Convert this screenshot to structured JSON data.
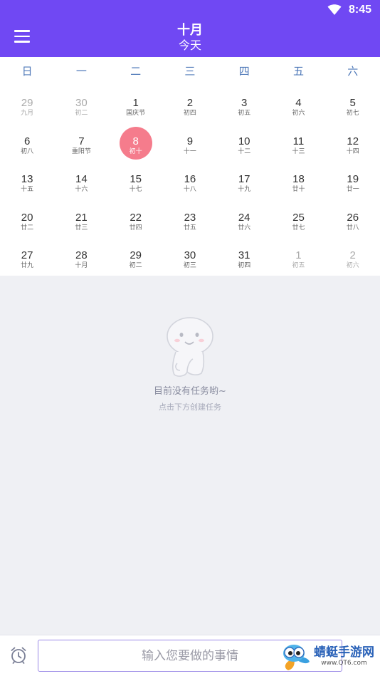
{
  "status": {
    "time": "8:45"
  },
  "header": {
    "month": "十月",
    "today": "今天"
  },
  "weekdays": [
    "日",
    "一",
    "二",
    "三",
    "四",
    "五",
    "六"
  ],
  "weeks": [
    [
      {
        "day": "29",
        "sub": "九月",
        "other": true
      },
      {
        "day": "30",
        "sub": "初二",
        "other": true
      },
      {
        "day": "1",
        "sub": "国庆节"
      },
      {
        "day": "2",
        "sub": "初四"
      },
      {
        "day": "3",
        "sub": "初五"
      },
      {
        "day": "4",
        "sub": "初六"
      },
      {
        "day": "5",
        "sub": "初七"
      }
    ],
    [
      {
        "day": "6",
        "sub": "初八"
      },
      {
        "day": "7",
        "sub": "重阳节"
      },
      {
        "day": "8",
        "sub": "初十",
        "selected": true
      },
      {
        "day": "9",
        "sub": "十一"
      },
      {
        "day": "10",
        "sub": "十二"
      },
      {
        "day": "11",
        "sub": "十三"
      },
      {
        "day": "12",
        "sub": "十四"
      }
    ],
    [
      {
        "day": "13",
        "sub": "十五"
      },
      {
        "day": "14",
        "sub": "十六"
      },
      {
        "day": "15",
        "sub": "十七"
      },
      {
        "day": "16",
        "sub": "十八"
      },
      {
        "day": "17",
        "sub": "十九"
      },
      {
        "day": "18",
        "sub": "廿十"
      },
      {
        "day": "19",
        "sub": "廿一"
      }
    ],
    [
      {
        "day": "20",
        "sub": "廿二"
      },
      {
        "day": "21",
        "sub": "廿三"
      },
      {
        "day": "22",
        "sub": "廿四"
      },
      {
        "day": "23",
        "sub": "廿五"
      },
      {
        "day": "24",
        "sub": "廿六"
      },
      {
        "day": "25",
        "sub": "廿七"
      },
      {
        "day": "26",
        "sub": "廿八"
      }
    ],
    [
      {
        "day": "27",
        "sub": "廿九"
      },
      {
        "day": "28",
        "sub": "十月"
      },
      {
        "day": "29",
        "sub": "初二"
      },
      {
        "day": "30",
        "sub": "初三"
      },
      {
        "day": "31",
        "sub": "初四"
      },
      {
        "day": "1",
        "sub": "初五",
        "other": true
      },
      {
        "day": "2",
        "sub": "初六",
        "other": true
      }
    ]
  ],
  "empty": {
    "title": "目前没有任务哟~",
    "subtitle": "点击下方创建任务"
  },
  "input": {
    "placeholder": "输入您要做的事情"
  },
  "watermark": {
    "name": "蜻蜓手游网",
    "url": "www.QT6.com"
  },
  "colors": {
    "primary": "#7048f3",
    "selected": "#f57c8c",
    "weekday": "#4e78b8"
  }
}
